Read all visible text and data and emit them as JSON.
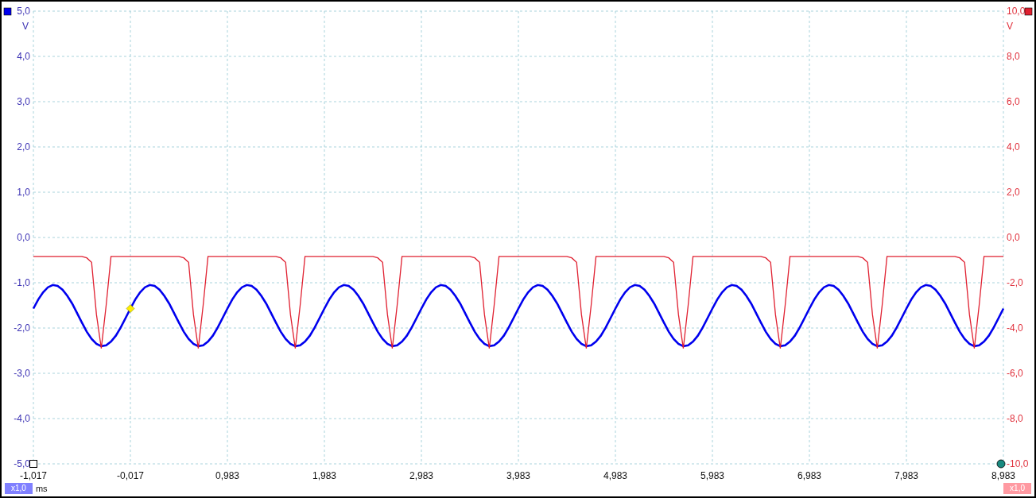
{
  "chart_data": {
    "type": "line",
    "xlabel": "ms",
    "ylabel": "V",
    "y2label": "V",
    "xlim": [
      -1.017,
      8.983
    ],
    "ylim": [
      -5,
      5
    ],
    "y2lim": [
      -10,
      10
    ],
    "xticks": [
      {
        "value": -1.017,
        "label": "-1,017"
      },
      {
        "value": -0.017,
        "label": "-0,017"
      },
      {
        "value": 0.983,
        "label": "0,983"
      },
      {
        "value": 1.983,
        "label": "1,983"
      },
      {
        "value": 2.983,
        "label": "2,983"
      },
      {
        "value": 3.983,
        "label": "3,983"
      },
      {
        "value": 4.983,
        "label": "4,983"
      },
      {
        "value": 5.983,
        "label": "5,983"
      },
      {
        "value": 6.983,
        "label": "6,983"
      },
      {
        "value": 7.983,
        "label": "7,983"
      },
      {
        "value": 8.983,
        "label": "8,983"
      }
    ],
    "yticks": [
      {
        "value": 5,
        "label": "5,0"
      },
      {
        "value": 4,
        "label": "4,0"
      },
      {
        "value": 3,
        "label": "3,0"
      },
      {
        "value": 2,
        "label": "2,0"
      },
      {
        "value": 1,
        "label": "1,0"
      },
      {
        "value": 0,
        "label": "0,0"
      },
      {
        "value": -1,
        "label": "-1,0"
      },
      {
        "value": -2,
        "label": "-2,0"
      },
      {
        "value": -3,
        "label": "-3,0"
      },
      {
        "value": -4,
        "label": "-4,0"
      },
      {
        "value": -5,
        "label": "-5,0"
      }
    ],
    "y2ticks": [
      {
        "value": 10,
        "label": "10,0"
      },
      {
        "value": 8,
        "label": "8,0"
      },
      {
        "value": 6,
        "label": "6,0"
      },
      {
        "value": 4,
        "label": "4,0"
      },
      {
        "value": 2,
        "label": "2,0"
      },
      {
        "value": 0,
        "label": "0,0"
      },
      {
        "value": -2,
        "label": "-2,0"
      },
      {
        "value": -4,
        "label": "-4,0"
      },
      {
        "value": -6,
        "label": "-6,0"
      },
      {
        "value": -8,
        "label": "-8,0"
      },
      {
        "value": -10,
        "label": "-10,0"
      }
    ],
    "x": [
      -1.017,
      -0.967,
      -0.917,
      -0.867,
      -0.817,
      -0.767,
      -0.717,
      -0.667,
      -0.617,
      -0.567,
      -0.517,
      -0.467,
      -0.417,
      -0.367,
      -0.317,
      -0.267,
      -0.217,
      -0.167,
      -0.117,
      -0.067,
      -0.017,
      0.033,
      0.083,
      0.133,
      0.183,
      0.233,
      0.283,
      0.333,
      0.383,
      0.433,
      0.483,
      0.533,
      0.583,
      0.633,
      0.683,
      0.733,
      0.783,
      0.833,
      0.883,
      0.933,
      0.983,
      1.033,
      1.083,
      1.133,
      1.183,
      1.233,
      1.283,
      1.333,
      1.383,
      1.433,
      1.483,
      1.533,
      1.583,
      1.633,
      1.683,
      1.733,
      1.783,
      1.833,
      1.883,
      1.933,
      1.983,
      2.033,
      2.083,
      2.133,
      2.183,
      2.233,
      2.283,
      2.333,
      2.383,
      2.433,
      2.483,
      2.533,
      2.583,
      2.633,
      2.683,
      2.733,
      2.783,
      2.833,
      2.883,
      2.933,
      2.983,
      3.033,
      3.083,
      3.133,
      3.183,
      3.233,
      3.283,
      3.333,
      3.383,
      3.433,
      3.483,
      3.533,
      3.583,
      3.633,
      3.683,
      3.733,
      3.783,
      3.833,
      3.883,
      3.933,
      3.983,
      4.033,
      4.083,
      4.133,
      4.183,
      4.233,
      4.283,
      4.333,
      4.383,
      4.433,
      4.483,
      4.533,
      4.583,
      4.633,
      4.683,
      4.733,
      4.783,
      4.833,
      4.883,
      4.933,
      4.983,
      5.033,
      5.083,
      5.133,
      5.183,
      5.233,
      5.283,
      5.333,
      5.383,
      5.433,
      5.483,
      5.533,
      5.583,
      5.633,
      5.683,
      5.733,
      5.783,
      5.833,
      5.883,
      5.933,
      5.983,
      6.033,
      6.083,
      6.133,
      6.183,
      6.233,
      6.283,
      6.333,
      6.383,
      6.433,
      6.483,
      6.533,
      6.583,
      6.633,
      6.683,
      6.733,
      6.783,
      6.833,
      6.883,
      6.933,
      6.983,
      7.033,
      7.083,
      7.133,
      7.183,
      7.233,
      7.283,
      7.333,
      7.383,
      7.433,
      7.483,
      7.533,
      7.583,
      7.633,
      7.683,
      7.733,
      7.783,
      7.833,
      7.883,
      7.933,
      7.983,
      8.033,
      8.083,
      8.133,
      8.183,
      8.233,
      8.283,
      8.333,
      8.383,
      8.433,
      8.483,
      8.533,
      8.583,
      8.633,
      8.683,
      8.733,
      8.783,
      8.833,
      8.883,
      8.933,
      8.983
    ],
    "series": [
      {
        "color": "#0000ee",
        "axis": "y",
        "values": [
          -1.57,
          -1.37,
          -1.21,
          -1.1,
          -1.05,
          -1.07,
          -1.15,
          -1.29,
          -1.46,
          -1.67,
          -1.88,
          -2.08,
          -2.24,
          -2.35,
          -2.4,
          -2.38,
          -2.3,
          -2.17,
          -1.99,
          -1.78,
          -1.57,
          -1.37,
          -1.21,
          -1.1,
          -1.05,
          -1.07,
          -1.15,
          -1.29,
          -1.46,
          -1.67,
          -1.88,
          -2.08,
          -2.24,
          -2.35,
          -2.4,
          -2.38,
          -2.3,
          -2.17,
          -1.99,
          -1.78,
          -1.57,
          -1.37,
          -1.21,
          -1.1,
          -1.05,
          -1.07,
          -1.15,
          -1.29,
          -1.46,
          -1.67,
          -1.88,
          -2.08,
          -2.24,
          -2.35,
          -2.4,
          -2.38,
          -2.3,
          -2.17,
          -1.99,
          -1.78,
          -1.57,
          -1.37,
          -1.21,
          -1.1,
          -1.05,
          -1.07,
          -1.15,
          -1.29,
          -1.46,
          -1.67,
          -1.88,
          -2.08,
          -2.24,
          -2.35,
          -2.4,
          -2.38,
          -2.3,
          -2.17,
          -1.99,
          -1.78,
          -1.57,
          -1.37,
          -1.21,
          -1.1,
          -1.05,
          -1.07,
          -1.15,
          -1.29,
          -1.46,
          -1.67,
          -1.88,
          -2.08,
          -2.24,
          -2.35,
          -2.4,
          -2.38,
          -2.3,
          -2.17,
          -1.99,
          -1.78,
          -1.57,
          -1.37,
          -1.21,
          -1.1,
          -1.05,
          -1.07,
          -1.15,
          -1.29,
          -1.46,
          -1.67,
          -1.88,
          -2.08,
          -2.24,
          -2.35,
          -2.4,
          -2.38,
          -2.3,
          -2.17,
          -1.99,
          -1.78,
          -1.57,
          -1.37,
          -1.21,
          -1.1,
          -1.05,
          -1.07,
          -1.15,
          -1.29,
          -1.46,
          -1.67,
          -1.88,
          -2.08,
          -2.24,
          -2.35,
          -2.4,
          -2.38,
          -2.3,
          -2.17,
          -1.99,
          -1.78,
          -1.57,
          -1.37,
          -1.21,
          -1.1,
          -1.05,
          -1.07,
          -1.15,
          -1.29,
          -1.46,
          -1.67,
          -1.88,
          -2.08,
          -2.24,
          -2.35,
          -2.4,
          -2.38,
          -2.3,
          -2.17,
          -1.99,
          -1.78,
          -1.57,
          -1.37,
          -1.21,
          -1.1,
          -1.05,
          -1.07,
          -1.15,
          -1.29,
          -1.46,
          -1.67,
          -1.88,
          -2.08,
          -2.24,
          -2.35,
          -2.4,
          -2.38,
          -2.3,
          -2.17,
          -1.99,
          -1.78,
          -1.57,
          -1.37,
          -1.21,
          -1.1,
          -1.05,
          -1.07,
          -1.15,
          -1.29,
          -1.46,
          -1.67,
          -1.88,
          -2.08,
          -2.24,
          -2.35,
          -2.4,
          -2.38,
          -2.3,
          -2.17,
          -1.99,
          -1.78,
          -1.57
        ]
      },
      {
        "color": "#e02030",
        "axis": "y2",
        "values": [
          -0.84,
          -0.84,
          -0.84,
          -0.84,
          -0.84,
          -0.84,
          -0.84,
          -0.84,
          -0.84,
          -0.84,
          -0.84,
          -0.9,
          -1.1,
          -3.4,
          -4.9,
          -3.0,
          -0.84,
          -0.84,
          -0.84,
          -0.84,
          -0.84,
          -0.84,
          -0.84,
          -0.84,
          -0.84,
          -0.84,
          -0.84,
          -0.84,
          -0.84,
          -0.84,
          -0.84,
          -0.9,
          -1.1,
          -3.4,
          -4.9,
          -3.0,
          -0.84,
          -0.84,
          -0.84,
          -0.84,
          -0.84,
          -0.84,
          -0.84,
          -0.84,
          -0.84,
          -0.84,
          -0.84,
          -0.84,
          -0.84,
          -0.84,
          -0.84,
          -0.9,
          -1.1,
          -3.4,
          -4.9,
          -3.0,
          -0.84,
          -0.84,
          -0.84,
          -0.84,
          -0.84,
          -0.84,
          -0.84,
          -0.84,
          -0.84,
          -0.84,
          -0.84,
          -0.84,
          -0.84,
          -0.84,
          -0.84,
          -0.9,
          -1.1,
          -3.4,
          -4.9,
          -3.0,
          -0.84,
          -0.84,
          -0.84,
          -0.84,
          -0.84,
          -0.84,
          -0.84,
          -0.84,
          -0.84,
          -0.84,
          -0.84,
          -0.84,
          -0.84,
          -0.84,
          -0.84,
          -0.9,
          -1.1,
          -3.4,
          -4.9,
          -3.0,
          -0.84,
          -0.84,
          -0.84,
          -0.84,
          -0.84,
          -0.84,
          -0.84,
          -0.84,
          -0.84,
          -0.84,
          -0.84,
          -0.84,
          -0.84,
          -0.84,
          -0.84,
          -0.9,
          -1.1,
          -3.4,
          -4.9,
          -3.0,
          -0.84,
          -0.84,
          -0.84,
          -0.84,
          -0.84,
          -0.84,
          -0.84,
          -0.84,
          -0.84,
          -0.84,
          -0.84,
          -0.84,
          -0.84,
          -0.84,
          -0.84,
          -0.9,
          -1.1,
          -3.4,
          -4.9,
          -3.0,
          -0.84,
          -0.84,
          -0.84,
          -0.84,
          -0.84,
          -0.84,
          -0.84,
          -0.84,
          -0.84,
          -0.84,
          -0.84,
          -0.84,
          -0.84,
          -0.84,
          -0.84,
          -0.9,
          -1.1,
          -3.4,
          -4.9,
          -3.0,
          -0.84,
          -0.84,
          -0.84,
          -0.84,
          -0.84,
          -0.84,
          -0.84,
          -0.84,
          -0.84,
          -0.84,
          -0.84,
          -0.84,
          -0.84,
          -0.84,
          -0.84,
          -0.9,
          -1.1,
          -3.4,
          -4.9,
          -3.0,
          -0.84,
          -0.84,
          -0.84,
          -0.84,
          -0.84,
          -0.84,
          -0.84,
          -0.84,
          -0.84,
          -0.84,
          -0.84,
          -0.84,
          -0.84,
          -0.84,
          -0.84,
          -0.9,
          -1.1,
          -3.4,
          -4.9,
          -3.0,
          -0.84,
          -0.84,
          -0.84,
          -0.84,
          -0.84
        ]
      }
    ],
    "grid": true
  },
  "x_scale_left": "x1,0",
  "x_scale_right": "x1,0"
}
